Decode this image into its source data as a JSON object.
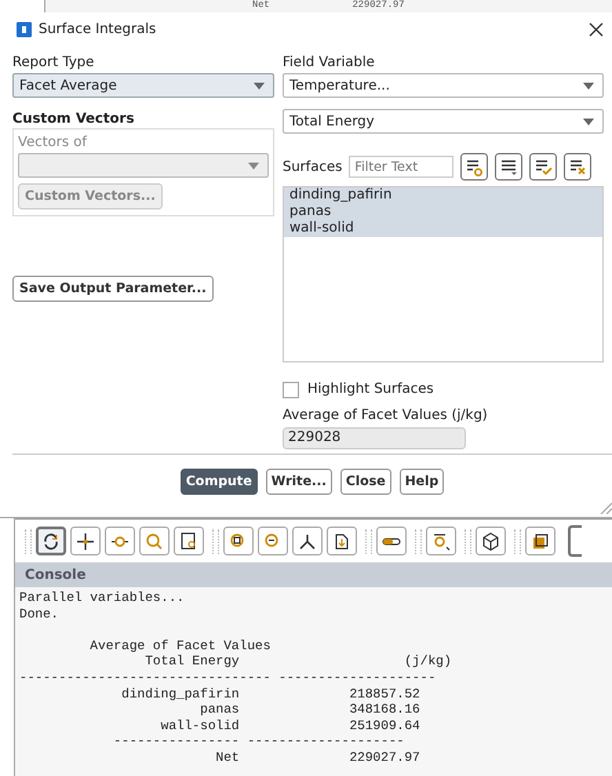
{
  "background_console": {
    "label": "Net",
    "value": "229027.97"
  },
  "window": {
    "title": "Surface Integrals"
  },
  "report_type": {
    "label": "Report Type",
    "value": "Facet Average"
  },
  "custom_vectors": {
    "title": "Custom Vectors",
    "vectors_of_label": "Vectors of",
    "button": "Custom Vectors..."
  },
  "save_button": "Save Output Parameter...",
  "field_variable": {
    "label": "Field Variable",
    "category": "Temperature...",
    "value": "Total Energy"
  },
  "surfaces": {
    "label": "Surfaces",
    "filter_placeholder": "Filter Text",
    "items": [
      {
        "name": "dinding_pafirin",
        "selected": true
      },
      {
        "name": "panas",
        "selected": true
      },
      {
        "name": "wall-solid",
        "selected": true
      }
    ]
  },
  "highlight_surfaces": {
    "label": "Highlight Surfaces",
    "checked": false
  },
  "result": {
    "label": "Average of Facet Values (j/kg)",
    "value": "229028"
  },
  "buttons": [
    {
      "label": "Compute",
      "primary": true
    },
    {
      "label": "Write...",
      "primary": false
    },
    {
      "label": "Close",
      "primary": false
    },
    {
      "label": "Help",
      "primary": false
    }
  ],
  "toolbar": [
    {
      "selected": true
    },
    {
      "selected": false
    },
    {
      "selected": false
    },
    {
      "selected": false
    },
    {
      "selected": false
    },
    {
      "selected": false
    },
    {
      "selected": false
    },
    {
      "selected": false
    },
    {
      "selected": false
    },
    {
      "selected": false
    },
    {
      "selected": false
    },
    {
      "selected": false
    },
    {
      "selected": false
    }
  ],
  "console": {
    "title": "Console",
    "status_lines": [
      "Parallel variables...",
      "Done."
    ],
    "report_lines": [
      "         Average of Facet Values",
      "                Total Energy                     (j/kg)",
      "-------------------------------- --------------------",
      "             dinding_pafirin              218857.52",
      "                       panas              348168.16",
      "                  wall-solid              251909.64",
      "            ---------------- --------------------",
      "                         Net              229027.97"
    ]
  }
}
